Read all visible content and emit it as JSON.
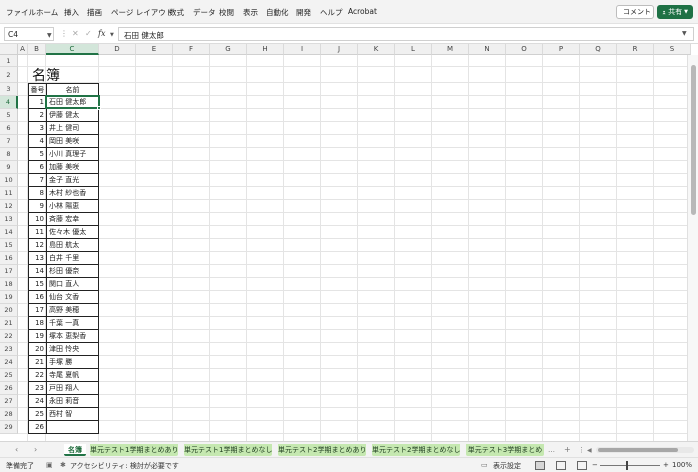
{
  "ribbon": {
    "tabs": [
      "ファイル",
      "ホーム",
      "挿入",
      "描画",
      "ページ レイアウト",
      "数式",
      "データ",
      "校閲",
      "表示",
      "自動化",
      "開発",
      "ヘルプ",
      "Acrobat"
    ],
    "comment_label": "コメント",
    "share_label": "共有"
  },
  "formula_bar": {
    "cell_ref": "C4",
    "fx_label": "fx",
    "content": "石田 健太郎"
  },
  "columns": [
    "A",
    "B",
    "C",
    "D",
    "E",
    "F",
    "G",
    "H",
    "I",
    "J",
    "K",
    "L",
    "M",
    "N",
    "O",
    "P",
    "Q",
    "R",
    "S"
  ],
  "selected_column": "C",
  "selected_row": 4,
  "rows": [
    "1",
    "2",
    "3",
    "4",
    "5",
    "6",
    "7",
    "8",
    "9",
    "10",
    "11",
    "12",
    "13",
    "14",
    "15",
    "16",
    "17",
    "18",
    "19",
    "20",
    "21",
    "22",
    "23",
    "24",
    "25",
    "26",
    "27",
    "28",
    "29"
  ],
  "sheet": {
    "title": "名簿",
    "headers": [
      "番号",
      "名前"
    ],
    "entries": [
      [
        "1",
        "石田 健太郎"
      ],
      [
        "2",
        "伊藤 健太"
      ],
      [
        "3",
        "井上 健司"
      ],
      [
        "4",
        "岡田 美咲"
      ],
      [
        "5",
        "小川 真理子"
      ],
      [
        "6",
        "加藤 美咲"
      ],
      [
        "7",
        "金子 直光"
      ],
      [
        "8",
        "木村 紗也香"
      ],
      [
        "9",
        "小林 陽恵"
      ],
      [
        "10",
        "斉藤 宏幸"
      ],
      [
        "11",
        "佐々木 優太"
      ],
      [
        "12",
        "島田 航太"
      ],
      [
        "13",
        "白井 千里"
      ],
      [
        "14",
        "杉田 優奈"
      ],
      [
        "15",
        "関口 直人"
      ],
      [
        "16",
        "仙台 文香"
      ],
      [
        "17",
        "高野 美穂"
      ],
      [
        "18",
        "千葉 一真"
      ],
      [
        "19",
        "塚本 恵梨香"
      ],
      [
        "20",
        "津田 怜央"
      ],
      [
        "21",
        "手塚 勝"
      ],
      [
        "22",
        "寺尾 夏帆"
      ],
      [
        "23",
        "戸田 翔人"
      ],
      [
        "24",
        "永田 莉音"
      ],
      [
        "25",
        "西村 智"
      ],
      [
        "26",
        ""
      ]
    ]
  },
  "sheet_tabs": [
    "名簿",
    "単元テスト1学期まとめあり",
    "単元テスト1学期まとめなし",
    "単元テスト2学期まとめあり",
    "単元テスト2学期まとめなし",
    "単元テスト3学期まとめ"
  ],
  "statusbar": {
    "ready": "準備完了",
    "accessibility": "アクセシビリティ: 検討が必要です",
    "display_settings": "表示設定",
    "zoom": "100%"
  }
}
